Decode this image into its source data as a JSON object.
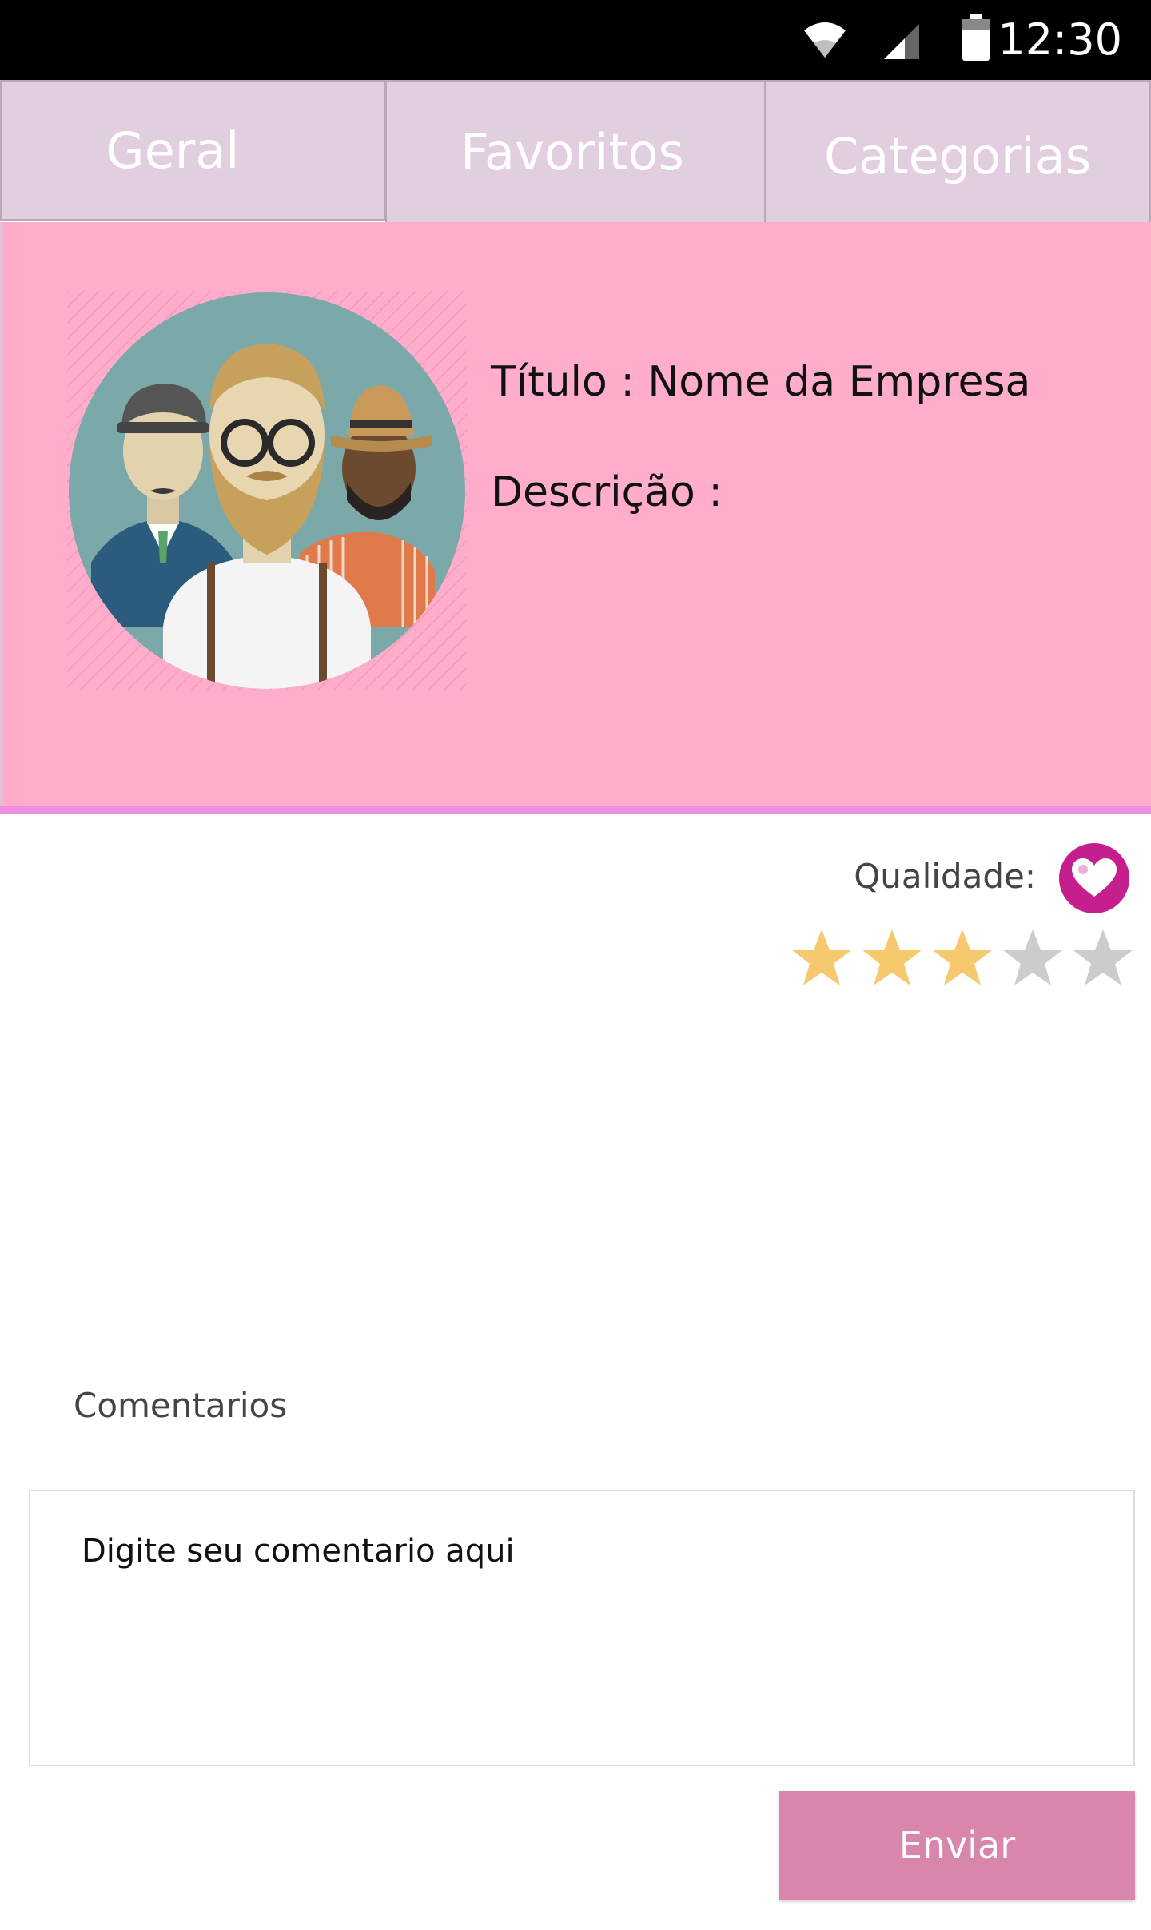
{
  "status_bar": {
    "time": "12:30",
    "icons": [
      "wifi-icon",
      "cell-signal-icon",
      "battery-icon"
    ]
  },
  "tabs": [
    {
      "label": "Geral"
    },
    {
      "label": "Favoritos"
    },
    {
      "label": "Categorias"
    }
  ],
  "profile": {
    "title_label": "Título :",
    "title_value": "Nome da Empresa",
    "description_label": "Descrição :",
    "avatar": "group-of-three-men-avatar"
  },
  "rating": {
    "label": "Qualidade:",
    "value": 3,
    "max": 5,
    "favorite_icon": "heart-icon"
  },
  "comments": {
    "label": "Comentarios",
    "placeholder": "Digite seu comentario aqui",
    "value": "",
    "send_label": "Enviar"
  },
  "colors": {
    "tab_background": "#e1cfe0",
    "card_background": "#ffadca",
    "card_underline": "#ee8fde",
    "favorite_button": "#c51f8e",
    "star_filled": "#f6c96f",
    "star_empty": "#cccccc",
    "send_button": "#d886ab"
  }
}
